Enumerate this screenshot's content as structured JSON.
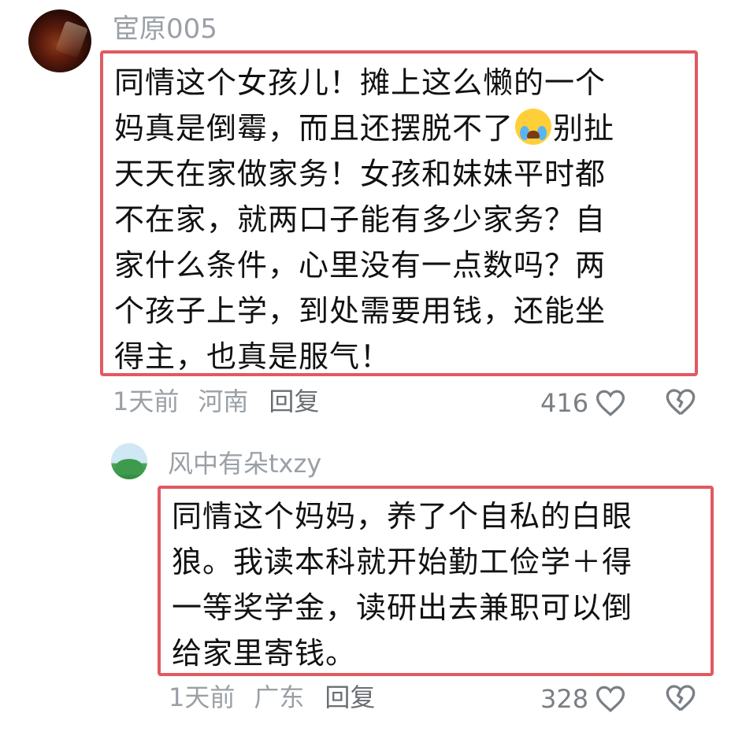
{
  "comment": {
    "username": "宦原005",
    "text": [
      "同情这个女孩儿！摊上这么懒的一个",
      "妈真是倒霉，而且还摆脱不了",
      "别扯",
      "天天在家做家务！女孩和妹妹平时都",
      "不在家，就两口子能有多少家务？自",
      "家什么条件，心里没有一点数吗？两",
      "个孩子上学，到处需要用钱，还能坐",
      "得主，也真是服气！"
    ],
    "emoji": "crying-face",
    "time": "1天前",
    "region": "河南",
    "reply_label": "回复",
    "likes": "416"
  },
  "reply": {
    "username": "风中有朵txzy",
    "text": [
      "同情这个妈妈，养了个自私的白眼",
      "狼。我读本科就开始勤工俭学＋得",
      "一等奖学金，读研出去兼职可以倒",
      "给家里寄钱。"
    ],
    "time": "1天前",
    "region": "广东",
    "reply_label": "回复",
    "likes": "328"
  },
  "colors": {
    "highlight_border": "#e05a60",
    "meta_text": "#9aa0a6"
  }
}
